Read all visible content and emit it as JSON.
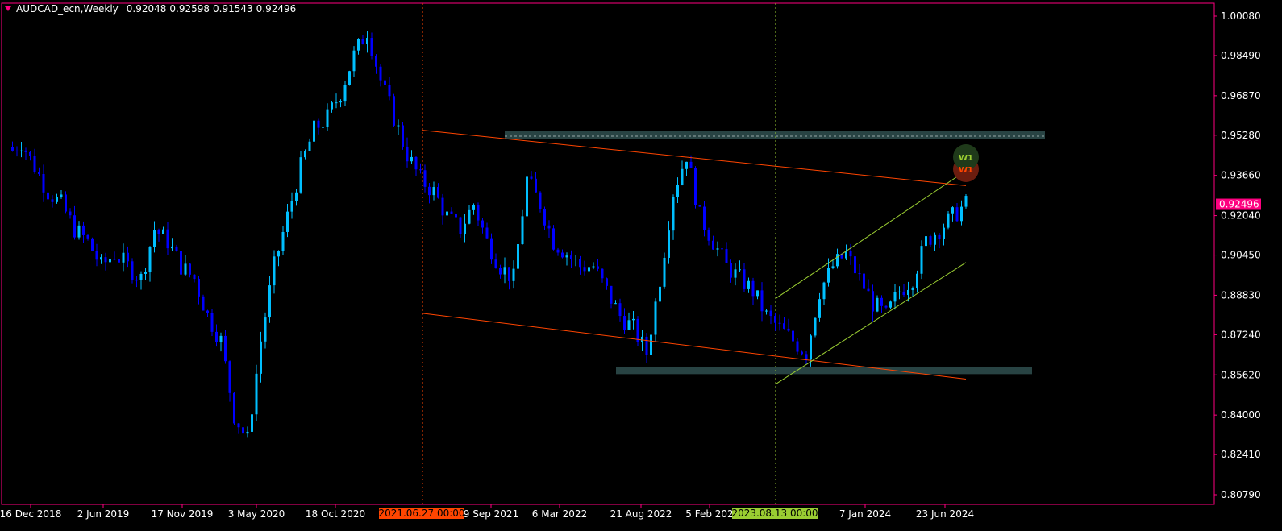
{
  "header": {
    "symbol": "AUDCAD_ecn,Weekly",
    "open": "0.92048",
    "high": "0.92598",
    "low": "0.91543",
    "close": "0.92496"
  },
  "price_badge": "0.92496",
  "markers": {
    "vline_left_label": "2021.06.27 00:00",
    "vline_right_label": "2023.08.13 00:00",
    "w1_upper": "W1",
    "w1_lower": "W1"
  },
  "colors": {
    "background": "#000000",
    "frame": "#ff0080",
    "bull": "#00bfff",
    "bear": "#0000ff",
    "channel_red": "#ff4500",
    "channel_green": "#9acd32",
    "zone": "#2f4f4f",
    "label_orange": "#ff4500",
    "label_green": "#9acd32"
  },
  "chart_data": {
    "type": "candlestick",
    "title": "AUDCAD_ecn,Weekly",
    "y_ticks": [
      "1.00080",
      "0.98490",
      "0.96870",
      "0.95280",
      "0.93660",
      "0.92040",
      "0.90450",
      "0.88830",
      "0.87240",
      "0.85620",
      "0.84000",
      "0.82410",
      "0.80790"
    ],
    "x_ticks": [
      "16 Dec 2018",
      "2 Jun 2019",
      "17 Nov 2019",
      "3 May 2020",
      "18 Oct 2020",
      "9 Sep 2021",
      "6 Mar 2022",
      "21 Aug 2022",
      "5 Feb 202",
      "7 Jan 2024",
      "23 Jun 2024"
    ],
    "ylim": [
      0.804,
      1.006
    ],
    "series_close_approx": [
      0.945,
      0.95,
      0.94,
      0.93,
      0.925,
      0.915,
      0.91,
      0.9,
      0.905,
      0.9,
      0.895,
      0.915,
      0.91,
      0.9,
      0.895,
      0.88,
      0.87,
      0.84,
      0.83,
      0.87,
      0.9,
      0.92,
      0.94,
      0.955,
      0.96,
      0.97,
      0.985,
      0.995,
      0.975,
      0.96,
      0.945,
      0.935,
      0.93,
      0.92,
      0.915,
      0.925,
      0.91,
      0.9,
      0.895,
      0.935,
      0.925,
      0.91,
      0.905,
      0.9,
      0.9,
      0.89,
      0.88,
      0.875,
      0.865,
      0.895,
      0.93,
      0.945,
      0.92,
      0.91,
      0.9,
      0.895,
      0.89,
      0.88,
      0.875,
      0.87,
      0.865,
      0.89,
      0.9,
      0.905,
      0.895,
      0.885,
      0.88,
      0.89,
      0.895,
      0.91,
      0.915,
      0.92,
      0.925
    ],
    "annotations": {
      "resistance_zone": [
        0.9512,
        0.9545
      ],
      "support_zone": [
        0.8565,
        0.8595
      ],
      "descending_channel_upper": {
        "from": 0.9548,
        "to": 0.9325
      },
      "descending_channel_lower": {
        "from": 0.881,
        "to": 0.8545
      },
      "ascending_channel_upper": {
        "from": 0.887,
        "to": 0.9385
      },
      "ascending_channel_lower": {
        "from": 0.8525,
        "to": 0.9015
      },
      "dashed_level": 0.9524
    }
  }
}
